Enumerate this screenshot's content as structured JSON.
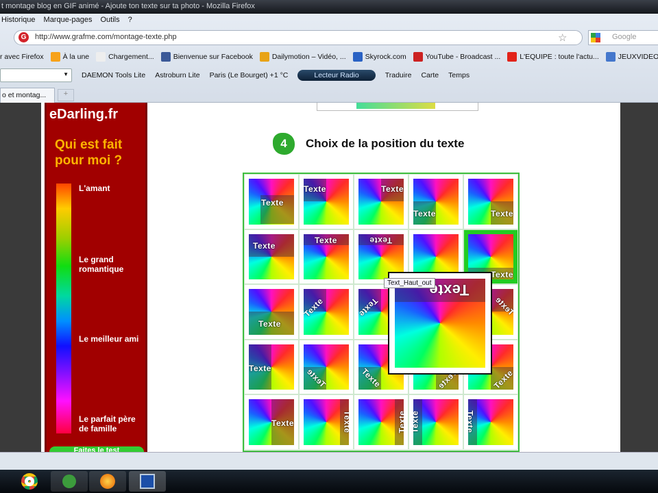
{
  "window": {
    "title": "t montage blog en GIF animé - Ajoute ton texte sur ta photo - Mozilla Firefox"
  },
  "menu": [
    "Historique",
    "Marque-pages",
    "Outils",
    "?"
  ],
  "nav": {
    "url": "http://www.grafme.com/montage-texte.php",
    "search_placeholder": "Google"
  },
  "bookmarks": [
    {
      "label": "r avec Firefox",
      "color": "#ffffff"
    },
    {
      "label": "À la une",
      "color": "#f7a21a"
    },
    {
      "label": "Chargement...",
      "color": "#eeeeee"
    },
    {
      "label": "Bienvenue sur Facebook",
      "color": "#3b5998"
    },
    {
      "label": "Dailymotion – Vidéo, ...",
      "color": "#e8a317"
    },
    {
      "label": "Skyrock.com",
      "color": "#2a62c4"
    },
    {
      "label": "YouTube - Broadcast ...",
      "color": "#cc2222"
    },
    {
      "label": "L'EQUIPE : toute l'actu...",
      "color": "#e2231a"
    },
    {
      "label": "JEUXVIDEO",
      "color": "#4477cc"
    }
  ],
  "toolbar": {
    "daemon": "DAEMON Tools Lite",
    "astroburn": "Astroburn Lite",
    "weather": "Paris (Le Bourget) +1 °C",
    "radio": "Lecteur Radio",
    "translate": "Traduire",
    "map": "Carte",
    "time": "Temps"
  },
  "tabs": [
    {
      "label": "o et montag..."
    }
  ],
  "ad": {
    "brand": "eDarling.fr",
    "title": "Qui est fait pour moi ?",
    "levels": [
      "L'amant",
      "Le grand romantique",
      "Le meilleur ami",
      "Le parfait père de famille"
    ],
    "button": "Faites le test"
  },
  "step": {
    "number": "4",
    "title": "Choix de la position du texte"
  },
  "grid": {
    "tiles": [
      "Texte",
      "Texte",
      "Texte",
      "Texte",
      "Texte",
      "Texte",
      "Texte",
      "Texte",
      "",
      "Texte",
      "Texte",
      "Texte",
      "Texte",
      "",
      "Texte",
      "Texte",
      "Texte",
      "Texte",
      "Texte",
      "Texte",
      "Texte",
      "Texte",
      "Texte",
      "Texte",
      "Texte"
    ],
    "selected_index": 9
  },
  "popup": {
    "label": "Texte",
    "tooltip": "Text_Haut_out"
  }
}
